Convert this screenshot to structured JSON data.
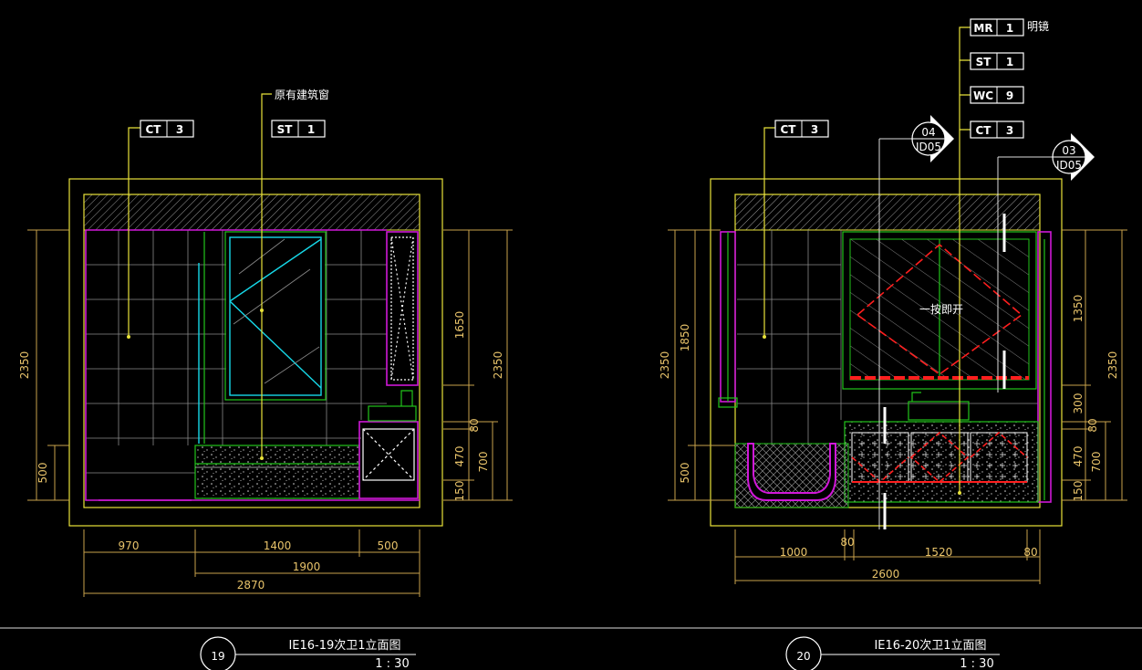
{
  "views": [
    {
      "number": "19",
      "title": "IE16-19次卫1立面图",
      "scale": "1 : 30",
      "tags": [
        {
          "code": "CT",
          "num": "3"
        },
        {
          "code": "ST",
          "num": "1"
        }
      ],
      "notes": [
        "原有建筑窗"
      ],
      "dims_bottom": [
        "970",
        "1400",
        "500",
        "1900",
        "2870"
      ],
      "dims_left": [
        "2350",
        "500"
      ],
      "dims_right_inner": [
        "1650",
        "80",
        "470",
        "150"
      ],
      "dims_right_outer": [
        "2350",
        "700"
      ]
    },
    {
      "number": "20",
      "title": "IE16-20次卫1立面图",
      "scale": "1 : 30",
      "tags": [
        {
          "code": "CT",
          "num": "3"
        },
        {
          "code": "MR",
          "num": "1"
        },
        {
          "code": "ST",
          "num": "1"
        },
        {
          "code": "WC",
          "num": "9"
        },
        {
          "code": "CT",
          "num": "3"
        }
      ],
      "notes": [
        "明镜",
        "一按即开"
      ],
      "section_marks": [
        {
          "num": "04",
          "ref": "ID05"
        },
        {
          "num": "03",
          "ref": "ID05"
        }
      ],
      "dims_bottom": [
        "80",
        "1000",
        "1520",
        "80",
        "2600"
      ],
      "dims_left": [
        "2350",
        "1850",
        "500"
      ],
      "dims_right_inner": [
        "1350",
        "300",
        "80",
        "470",
        "150"
      ],
      "dims_right_outer": [
        "2350",
        "700"
      ]
    }
  ],
  "colors": {
    "outline": "#e8e23a",
    "dimension": "#c9a24c",
    "tile": "#8a8a8a",
    "magenta": "#d018d8",
    "green": "#22c41a",
    "cyan": "#16d8e8",
    "red": "#ff1e1e"
  }
}
